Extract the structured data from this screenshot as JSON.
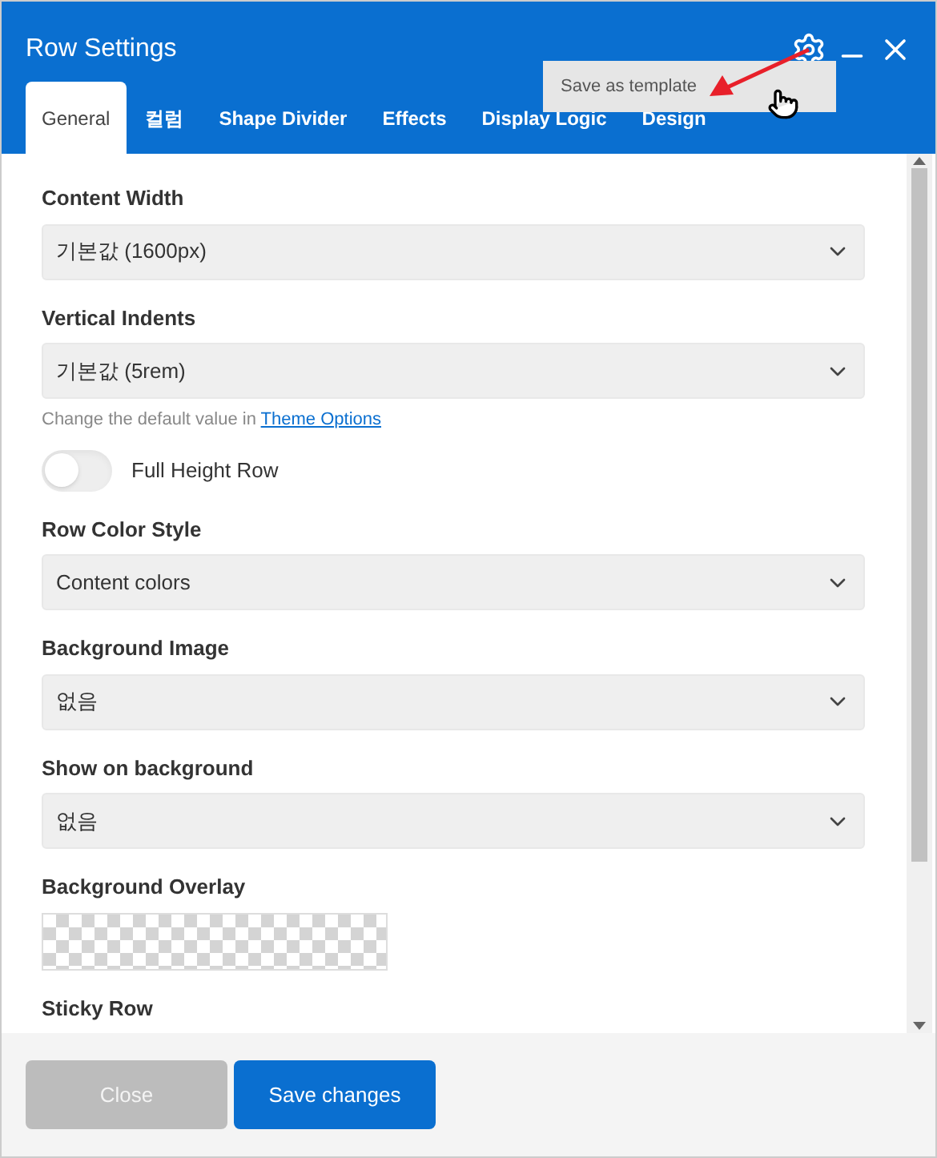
{
  "window": {
    "title": "Row Settings"
  },
  "tabs": [
    {
      "label": "General",
      "selected": true
    },
    {
      "label": "컬럼",
      "selected": false
    },
    {
      "label": "Shape Divider",
      "selected": false
    },
    {
      "label": "Effects",
      "selected": false
    },
    {
      "label": "Display Logic",
      "selected": false
    },
    {
      "label": "Design",
      "selected": false
    }
  ],
  "menu": {
    "items": [
      "Save as template"
    ]
  },
  "fields": [
    {
      "kind": "select",
      "label": "Content Width",
      "value": "기본값 (1600px)"
    },
    {
      "kind": "select",
      "label": "Vertical Indents",
      "value": "기본값 (5rem)",
      "hint": "Change the default value in ",
      "hint_link": "Theme Options"
    },
    {
      "kind": "toggle",
      "label": "Full Height Row",
      "on": false
    },
    {
      "kind": "select",
      "label": "Row Color Style",
      "value": "Content colors"
    },
    {
      "kind": "select",
      "label": "Background Image",
      "value": "없음"
    },
    {
      "kind": "select",
      "label": "Show on background",
      "value": "없음"
    },
    {
      "kind": "swatch",
      "label": "Background Overlay"
    },
    {
      "kind": "heading",
      "label": "Sticky Row"
    }
  ],
  "buttons": [
    {
      "kind": "secondary",
      "label": "Close"
    },
    {
      "kind": "primary",
      "label": "Save changes"
    }
  ]
}
